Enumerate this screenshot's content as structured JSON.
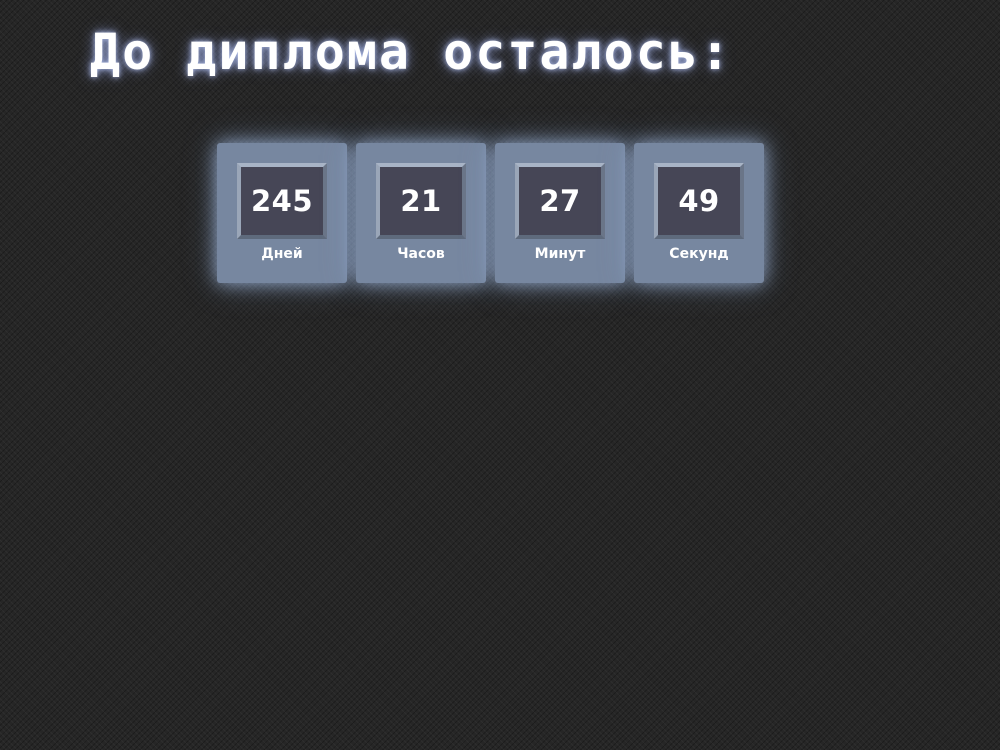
{
  "header": {
    "title": "До диплома осталось:"
  },
  "countdown": {
    "units": [
      {
        "value": "245",
        "label": "Дней"
      },
      {
        "value": "21",
        "label": "Часов"
      },
      {
        "value": "27",
        "label": "Минут"
      },
      {
        "value": "49",
        "label": "Секунд"
      }
    ]
  },
  "colors": {
    "background": "#262626",
    "card": "#7787a0",
    "digit_box": "#464656",
    "text": "#ffffff",
    "glow": "#aac3eb"
  }
}
